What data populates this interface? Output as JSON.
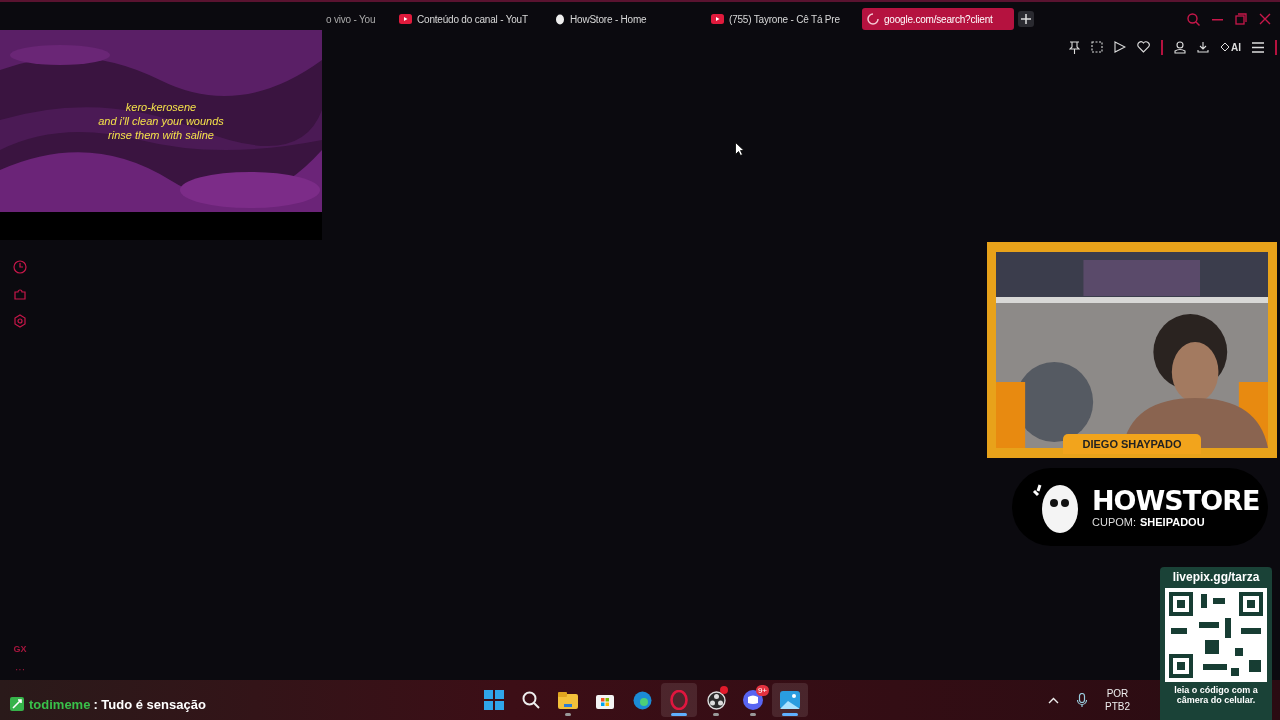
{
  "tabs": [
    {
      "title": "o vivo - You",
      "kind": "plain",
      "selected": false
    },
    {
      "title": "Conteúdo do canal - YouT",
      "kind": "youtube",
      "selected": false
    },
    {
      "title": "HowStore - Home",
      "kind": "site",
      "selected": false
    },
    {
      "title": "(755) Tayrone - Cê Tá Pre",
      "kind": "youtube",
      "selected": false
    },
    {
      "title": "google.com/search?client",
      "kind": "loading",
      "selected": true
    }
  ],
  "toolbar": {
    "ai_label": "AI"
  },
  "sidebar": {
    "brand": "GX",
    "more": "···"
  },
  "video_overlay": {
    "lyrics": [
      "kero-kerosene",
      "and i'll clean your wounds",
      "rinse them with saline"
    ]
  },
  "webcam": {
    "name": "DIEGO SHAYPADO"
  },
  "sponsor": {
    "brand": "HOWSTORE",
    "coupon_label": "CUPOM:",
    "coupon_code": "SHEIPADOU"
  },
  "donation": {
    "url": "livepix.gg/tarza",
    "caption": "leia o código com a câmera do celular."
  },
  "chat": {
    "user": "todimeme",
    "message": ": Tudo é sensação"
  },
  "taskbar": {
    "apps": [
      {
        "kind": "start",
        "running": false,
        "selected": false
      },
      {
        "kind": "search",
        "running": false,
        "selected": false
      },
      {
        "kind": "explorer",
        "running": true,
        "selected": false
      },
      {
        "kind": "store",
        "running": false,
        "selected": false
      },
      {
        "kind": "edge",
        "running": false,
        "selected": false
      },
      {
        "kind": "opera",
        "running": true,
        "selected": true
      },
      {
        "kind": "obs",
        "running": true,
        "selected": false,
        "alert": true
      },
      {
        "kind": "discord",
        "running": true,
        "selected": false,
        "badge": "9+"
      },
      {
        "kind": "photos",
        "running": true,
        "selected": true
      }
    ],
    "language": "POR",
    "layout": "PTB2"
  }
}
